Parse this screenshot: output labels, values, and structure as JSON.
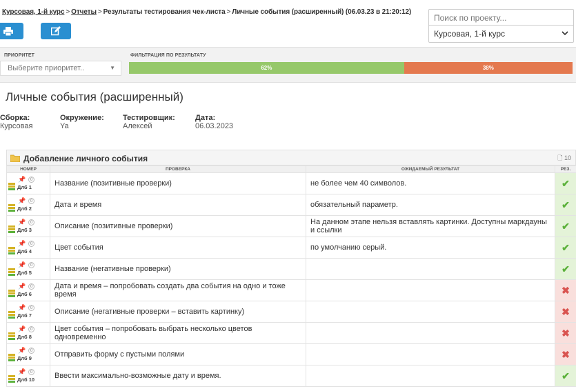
{
  "breadcrumb": {
    "project": "Курсовая, 1-й курс",
    "reports": "Отчеты",
    "report": "Результаты тестирования чек-листа",
    "current": "Личные события (расширенный) (06.03.23 в 21:20:12)",
    "separator": ">"
  },
  "toolbar": {
    "print_icon": "printer-icon",
    "edit_icon": "edit-icon",
    "accent": "#2a8fd1"
  },
  "search": {
    "placeholder": "Поиск по проекту..."
  },
  "project_select": {
    "value": "Курсовая, 1-й курс"
  },
  "filters": {
    "priority_label": "ПРИОРИТЕТ",
    "priority_placeholder": "Выберите приоритет..",
    "result_label": "ФИЛЬТРАЦИЯ ПО РЕЗУЛЬТАТУ",
    "pass_percent": "62%",
    "fail_percent": "38%",
    "pass_fraction": 0.62,
    "pass_color": "#96c86a",
    "fail_color": "#e4794f"
  },
  "page": {
    "title": "Личные события (расширенный)",
    "meta": {
      "build_label": "Сборка:",
      "build_value": "Курсовая",
      "env_label": "Окружение:",
      "env_value": "Ya",
      "tester_label": "Тестировщик:",
      "tester_value": "Алексей",
      "date_label": "Дата:",
      "date_value": "06.03.2023"
    }
  },
  "section": {
    "title": "Добавление личного события",
    "count": "10",
    "columns": {
      "number": "НОМЕР",
      "check": "ПРОВЕРКА",
      "expected": "ОЖИДАЕМЫЙ РЕЗУЛЬТАТ",
      "result": "РЕЗ."
    },
    "rows": [
      {
        "id": "Длб 1",
        "attachments": "0",
        "check": "Название (позитивные проверки)",
        "expected": "не более чем 40 символов.",
        "result": "pass"
      },
      {
        "id": "Длб 2",
        "attachments": "0",
        "check": "Дата и время",
        "expected": "обязательный параметр.",
        "result": "pass"
      },
      {
        "id": "Длб 3",
        "attachments": "0",
        "check": "Описание (позитивные проверки)",
        "expected": "На данном этапе нельзя вставлять картинки. Доступны маркдауны и ссылки",
        "result": "pass"
      },
      {
        "id": "Длб 4",
        "attachments": "0",
        "check": "Цвет события",
        "expected": "по умолчанию серый.",
        "result": "pass"
      },
      {
        "id": "Длб 5",
        "attachments": "0",
        "check": "Название (негативные проверки)",
        "expected": "",
        "result": "pass"
      },
      {
        "id": "Длб 6",
        "attachments": "0",
        "check": "Дата и время – попробовать создать два события на одно и тоже время",
        "expected": "",
        "result": "fail"
      },
      {
        "id": "Длб 7",
        "attachments": "0",
        "check": "Описание (негативные проверки – вставить картинку)",
        "expected": "",
        "result": "fail"
      },
      {
        "id": "Длб 8",
        "attachments": "0",
        "check": "Цвет события – попробовать выбрать несколько цветов одновременно",
        "expected": "",
        "result": "fail"
      },
      {
        "id": "Длб 9",
        "attachments": "0",
        "check": "Отправить форму с пустыми полями",
        "expected": "",
        "result": "fail"
      },
      {
        "id": "Длб 10",
        "attachments": "0",
        "check": "Ввести максимально-возможные дату и время.",
        "expected": "",
        "result": "pass"
      }
    ]
  }
}
